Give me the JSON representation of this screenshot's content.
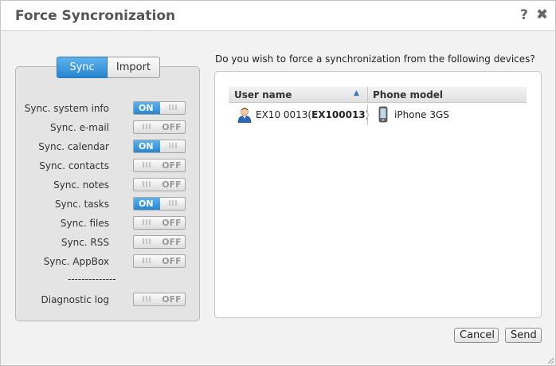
{
  "dialog": {
    "title": "Force Syncronization",
    "help_icon": "?",
    "close_icon": "✖"
  },
  "tabs": [
    {
      "label": "Sync",
      "active": true
    },
    {
      "label": "Import",
      "active": false
    }
  ],
  "toggle_text": {
    "on": "ON",
    "off": "OFF",
    "grip": "III"
  },
  "options": [
    {
      "label": "Sync. system info",
      "state": "on"
    },
    {
      "label": "Sync. e-mail",
      "state": "off"
    },
    {
      "label": "Sync. calendar",
      "state": "on"
    },
    {
      "label": "Sync. contacts",
      "state": "off"
    },
    {
      "label": "Sync. notes",
      "state": "off"
    },
    {
      "label": "Sync. tasks",
      "state": "on"
    },
    {
      "label": "Sync. files",
      "state": "off"
    },
    {
      "label": "Sync. RSS",
      "state": "off"
    },
    {
      "label": "Sync. AppBox",
      "state": "off"
    }
  ],
  "separator": "--------------",
  "diagnostic": {
    "label": "Diagnostic log",
    "state": "off"
  },
  "question": "Do you wish to force a synchronization from the following devices?",
  "grid": {
    "columns": {
      "user": "User name",
      "phone": "Phone model"
    },
    "sort_icon": "▲",
    "rows": [
      {
        "user_prefix": "EX10 0013(",
        "user_id": "EX100013",
        "user_suffix": ")",
        "phone": "iPhone 3GS"
      }
    ]
  },
  "buttons": {
    "cancel": "Cancel",
    "send": "Send"
  },
  "colors": {
    "accent": "#2786d0",
    "title": "#555555",
    "panel": "#e4e4e4"
  }
}
